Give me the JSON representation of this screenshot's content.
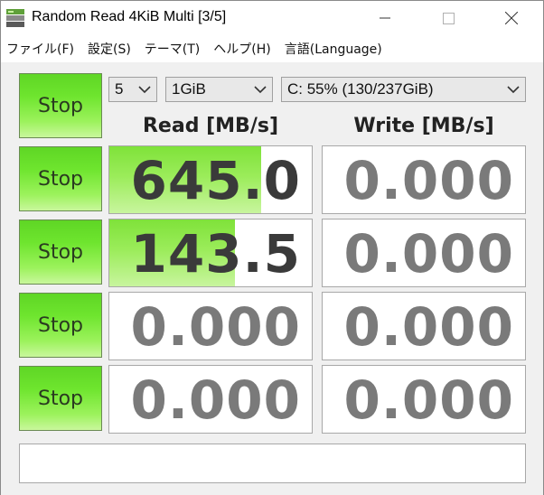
{
  "window": {
    "title": "Random Read 4KiB Multi [3/5]"
  },
  "menu": [
    "ファイル(F)",
    "設定(S)",
    "テーマ(T)",
    "ヘルプ(H)",
    "言語(Language)"
  ],
  "controls": {
    "count": "5",
    "size": "1GiB",
    "drive": "C: 55% (130/237GiB)"
  },
  "headers": {
    "read": "Read [MB/s]",
    "write": "Write [MB/s]"
  },
  "stop_buttons": [
    "Stop",
    "Stop",
    "Stop",
    "Stop",
    "Stop"
  ],
  "results": [
    {
      "read": "645.0",
      "write": "0.000",
      "read_fill": 0.75,
      "write_fill": 0
    },
    {
      "read": "143.5",
      "write": "0.000",
      "read_fill": 0.62,
      "write_fill": 0
    },
    {
      "read": "0.000",
      "write": "0.000",
      "read_fill": 0,
      "write_fill": 0
    },
    {
      "read": "0.000",
      "write": "0.000",
      "read_fill": 0,
      "write_fill": 0
    }
  ],
  "comment": "",
  "colors": {
    "button_green": "#6ee52e",
    "bar_green": "#9bec5a"
  }
}
